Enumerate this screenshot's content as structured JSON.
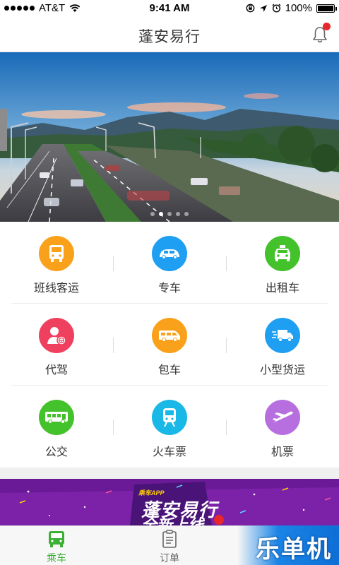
{
  "status_bar": {
    "carrier": "AT&T",
    "time": "9:41 AM",
    "battery": "100%"
  },
  "navbar": {
    "title": "蓬安易行",
    "has_notification": true
  },
  "banner": {
    "page_count": 5,
    "active_index": 1
  },
  "services": [
    {
      "label": "班线客运",
      "icon": "bus-icon",
      "color": "#f9a11b"
    },
    {
      "label": "专车",
      "icon": "car-icon",
      "color": "#1e9ff2"
    },
    {
      "label": "出租车",
      "icon": "taxi-icon",
      "color": "#43c22b"
    },
    {
      "label": "代驾",
      "icon": "chauffeur-icon",
      "color": "#f0405f"
    },
    {
      "label": "包车",
      "icon": "van-icon",
      "color": "#f9a11b"
    },
    {
      "label": "小型货运",
      "icon": "delivery-truck-icon",
      "color": "#1e9ff2"
    },
    {
      "label": "公交",
      "icon": "city-bus-icon",
      "color": "#43c22b"
    },
    {
      "label": "火车票",
      "icon": "train-icon",
      "color": "#1ab8e6"
    },
    {
      "label": "机票",
      "icon": "airplane-icon",
      "color": "#b76fe0"
    }
  ],
  "promo": {
    "subtitle": "乘车APP",
    "headline": "蓬安易行",
    "headline2": "全新上线"
  },
  "tabbar": {
    "tabs": [
      {
        "label": "乘车",
        "icon": "bus-icon",
        "active": true
      },
      {
        "label": "订单",
        "icon": "order-list-icon",
        "active": false
      }
    ],
    "active_color": "#3cb034",
    "inactive_color": "#666666"
  },
  "watermark": "乐单机"
}
